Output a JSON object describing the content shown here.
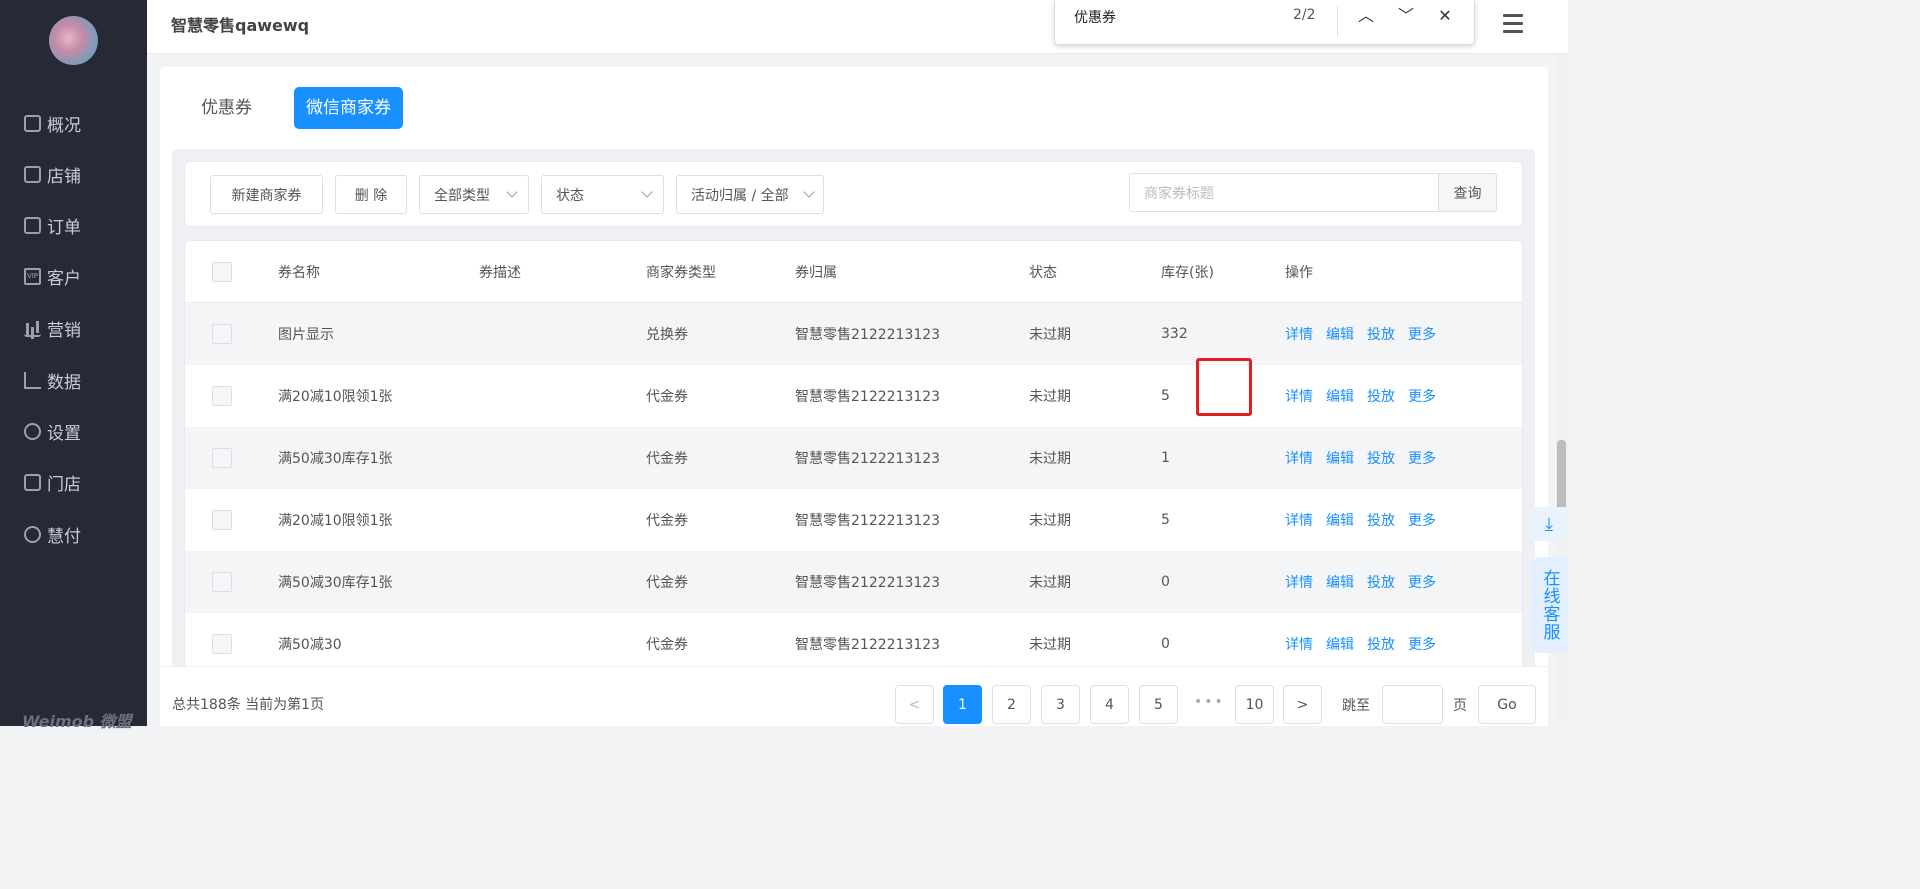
{
  "sidebar": {
    "items": [
      {
        "label": "概况",
        "icon": "box-icon"
      },
      {
        "label": "店铺",
        "icon": "store-icon"
      },
      {
        "label": "订单",
        "icon": "order-icon"
      },
      {
        "label": "客户",
        "icon": "vip-icon"
      },
      {
        "label": "营销",
        "icon": "bar-chart-icon"
      },
      {
        "label": "数据",
        "icon": "line-chart-icon"
      },
      {
        "label": "设置",
        "icon": "gear-icon"
      },
      {
        "label": "门店",
        "icon": "shop-icon"
      },
      {
        "label": "慧付",
        "icon": "pay-icon"
      }
    ],
    "brand": "Weimob 微盟"
  },
  "header": {
    "title": "智慧零售qawewq"
  },
  "findbar": {
    "query": "优惠券",
    "count": "2/2"
  },
  "tabs": [
    {
      "label": "优惠券",
      "active": false
    },
    {
      "label": "微信商家券",
      "active": true
    }
  ],
  "toolbar": {
    "new_label": "新建商家券",
    "delete_label": "删 除",
    "type_select": "全部类型",
    "status_select": "状态",
    "activity_select": "活动归属 / 全部",
    "search_placeholder": "商家券标题",
    "search_label": "查询"
  },
  "table": {
    "headers": [
      "券名称",
      "券描述",
      "商家券类型",
      "券归属",
      "状态",
      "库存(张)",
      "操作"
    ],
    "ops": [
      "详情",
      "编辑",
      "投放",
      "更多"
    ],
    "rows": [
      {
        "name": "图片显示",
        "desc": "",
        "type": "兑换券",
        "owner": "智慧零售2122213123",
        "status": "未过期",
        "stock": "332"
      },
      {
        "name": "满20减10限领1张",
        "desc": "",
        "type": "代金券",
        "owner": "智慧零售2122213123",
        "status": "未过期",
        "stock": "5"
      },
      {
        "name": "满50减30库存1张",
        "desc": "",
        "type": "代金券",
        "owner": "智慧零售2122213123",
        "status": "未过期",
        "stock": "1"
      },
      {
        "name": "满20减10限领1张",
        "desc": "",
        "type": "代金券",
        "owner": "智慧零售2122213123",
        "status": "未过期",
        "stock": "5"
      },
      {
        "name": "满50减30库存1张",
        "desc": "",
        "type": "代金券",
        "owner": "智慧零售2122213123",
        "status": "未过期",
        "stock": "0"
      },
      {
        "name": "满50减30",
        "desc": "",
        "type": "代金券",
        "owner": "智慧零售2122213123",
        "status": "未过期",
        "stock": "0"
      }
    ]
  },
  "pagination": {
    "total_text": "总共188条 当前为第1页",
    "pages": [
      "1",
      "2",
      "3",
      "4",
      "5"
    ],
    "last_page": "10",
    "current": "1",
    "jump_label": "跳至",
    "page_unit": "页",
    "go_label": "Go"
  },
  "widgets": {
    "customer_service": "在线客服"
  },
  "colors": {
    "accent": "#1890ff",
    "sidebar_bg": "#262a36",
    "highlight": "#e02020"
  }
}
